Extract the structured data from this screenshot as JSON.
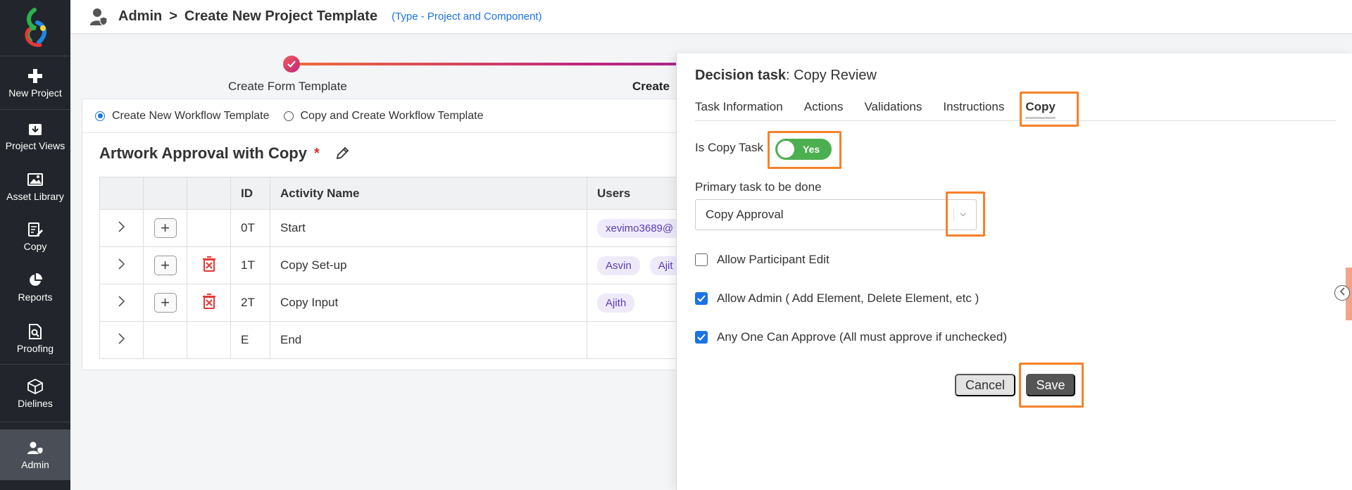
{
  "sidebar": {
    "items": [
      {
        "label": "New Project",
        "icon": "plus-icon"
      },
      {
        "label": "Project Views",
        "icon": "download-box-icon"
      },
      {
        "label": "Asset Library",
        "icon": "image-icon"
      },
      {
        "label": "Copy",
        "icon": "edit-document-icon"
      },
      {
        "label": "Reports",
        "icon": "pie-chart-icon"
      },
      {
        "label": "Proofing",
        "icon": "search-document-icon"
      },
      {
        "label": "Dielines",
        "icon": "box-icon"
      },
      {
        "label": "Admin",
        "icon": "admin-user-icon"
      }
    ]
  },
  "header": {
    "crumb_1": "Admin",
    "separator": ">",
    "crumb_2": "Create New Project Template",
    "type_note": "(Type - Project and Component)"
  },
  "stepper": {
    "step_1": "Create Form Template",
    "step_2": "Create"
  },
  "workflow": {
    "option_new": "Create New Workflow Template",
    "option_copy": "Copy and Create Workflow Template",
    "title": "Artwork Approval with Copy",
    "required_mark": "*",
    "columns": [
      "",
      "",
      "",
      "ID",
      "Activity Name",
      "Users"
    ],
    "rows": [
      {
        "id": "0T",
        "name": "Start",
        "users": [
          "xevimo3689@"
        ],
        "add": true,
        "delete": false
      },
      {
        "id": "1T",
        "name": "Copy Set-up",
        "users": [
          "Asvin",
          "Ajit"
        ],
        "add": true,
        "delete": true
      },
      {
        "id": "2T",
        "name": "Copy Input",
        "users": [
          "Ajith"
        ],
        "add": true,
        "delete": true
      },
      {
        "id": "E",
        "name": "End",
        "users": [],
        "add": false,
        "delete": false
      }
    ]
  },
  "panel": {
    "title_bold": "Decision task",
    "title_rest": ": Copy Review",
    "tabs": [
      "Task Information",
      "Actions",
      "Validations",
      "Instructions",
      "Copy"
    ],
    "active_tab": "Copy",
    "is_copy_label": "Is Copy Task",
    "toggle_text": "Yes",
    "primary_label": "Primary task to be done",
    "primary_value": "Copy Approval",
    "checks": [
      {
        "label": "Allow Participant Edit",
        "checked": false
      },
      {
        "label": "Allow Admin ( Add Element, Delete Element, etc )",
        "checked": true
      },
      {
        "label": "Any One Can Approve (All must approve if unchecked)",
        "checked": true
      }
    ],
    "cancel_label": "Cancel",
    "save_label": "Save"
  },
  "colors": {
    "highlight": "#f7812a",
    "toggle_on": "#4caf50",
    "accent": "#1a73e8",
    "sidebar_bg": "#22262c"
  }
}
